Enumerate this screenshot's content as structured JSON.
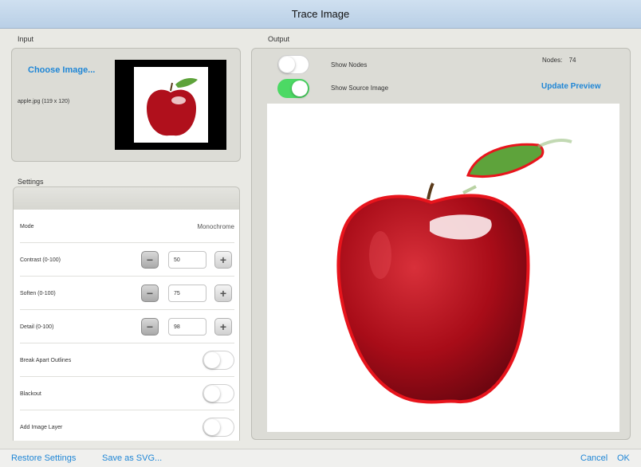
{
  "window": {
    "title": "Trace Image"
  },
  "input": {
    "section_label": "Input",
    "choose_image_label": "Choose Image...",
    "file_info": "apple.jpg (119 x 120)"
  },
  "settings": {
    "section_label": "Settings",
    "mode_label": "Mode",
    "mode_value": "Monochrome",
    "contrast_label": "Contrast (0-100)",
    "contrast_value": "50",
    "soften_label": "Soften (0-100)",
    "soften_value": "75",
    "detail_label": "Detail (0-100)",
    "detail_value": "98",
    "break_apart_label": "Break Apart Outlines",
    "break_apart_on": false,
    "blackout_label": "Blackout",
    "blackout_on": false,
    "add_image_layer_label": "Add Image Layer",
    "add_image_layer_on": false
  },
  "output": {
    "section_label": "Output",
    "show_nodes_label": "Show Nodes",
    "show_nodes_on": false,
    "show_source_label": "Show Source Image",
    "show_source_on": true,
    "nodes_label": "Nodes:",
    "nodes_count": "74",
    "update_preview_label": "Update Preview"
  },
  "footer": {
    "restore_settings_label": "Restore Settings",
    "save_svg_label": "Save as SVG...",
    "cancel_label": "Cancel",
    "ok_label": "OK"
  },
  "colors": {
    "accent": "#1f86d6",
    "toggle_on": "#4cd964",
    "trace_outline": "#e8141c",
    "apple_red": "#b0101c"
  }
}
